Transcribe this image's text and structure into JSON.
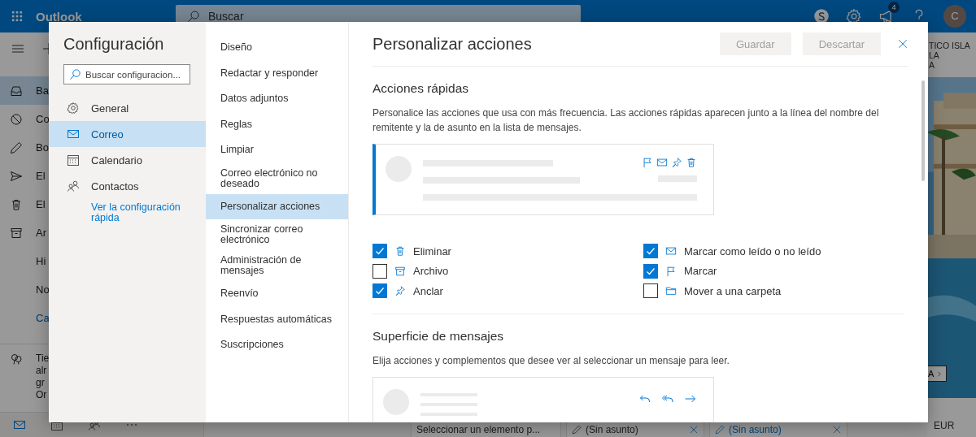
{
  "app": {
    "name": "Outlook",
    "search_placeholder": "Buscar",
    "notification_count": "4",
    "avatar_initial": "C"
  },
  "rail": {
    "items": [
      {
        "label": "Ba",
        "kind": "folder",
        "selected": true
      },
      {
        "label": "Co",
        "kind": "folder",
        "selected": false
      },
      {
        "label": "Bo",
        "kind": "folder",
        "selected": false
      },
      {
        "label": "El",
        "kind": "folder",
        "selected": false
      },
      {
        "label": "El",
        "kind": "folder",
        "selected": false
      },
      {
        "label": "Ar",
        "kind": "folder",
        "selected": false
      },
      {
        "label": "Hi",
        "kind": "folder",
        "selected": false
      },
      {
        "label": "No",
        "kind": "folder",
        "selected": false
      },
      {
        "label": "Ca",
        "kind": "link",
        "selected": false
      }
    ],
    "promo_lines": [
      "Tie",
      "alr",
      "gr",
      "Or"
    ]
  },
  "ad": {
    "lines": [
      "TICO ISLA",
      "LA",
      "A"
    ],
    "button": "A",
    "price": "EUR"
  },
  "bottom_tabs": [
    {
      "label": "Seleccionar un elemento p...",
      "kind": "plain"
    },
    {
      "label": "(Sin asunto)",
      "kind": "draft"
    },
    {
      "label": "(Sin asunto)",
      "kind": "draft-active"
    }
  ],
  "settings": {
    "title": "Configuración",
    "search_placeholder": "Buscar configuracion...",
    "categories": [
      {
        "label": "General",
        "selected": false
      },
      {
        "label": "Correo",
        "selected": true
      },
      {
        "label": "Calendario",
        "selected": false
      },
      {
        "label": "Contactos",
        "selected": false
      }
    ],
    "quick_link": "Ver la configuración rápida",
    "subsections": [
      {
        "label": "Diseño",
        "selected": false
      },
      {
        "label": "Redactar y responder",
        "selected": false
      },
      {
        "label": "Datos adjuntos",
        "selected": false
      },
      {
        "label": "Reglas",
        "selected": false
      },
      {
        "label": "Limpiar",
        "selected": false
      },
      {
        "label": "Correo electrónico no deseado",
        "selected": false
      },
      {
        "label": "Personalizar acciones",
        "selected": true
      },
      {
        "label": "Sincronizar correo electrónico",
        "selected": false
      },
      {
        "label": "Administración de mensajes",
        "selected": false
      },
      {
        "label": "Reenvío",
        "selected": false
      },
      {
        "label": "Respuestas automáticas",
        "selected": false
      },
      {
        "label": "Suscripciones",
        "selected": false
      }
    ],
    "panel": {
      "title": "Personalizar acciones",
      "buttons": [
        {
          "label": "Guardar",
          "disabled": true
        },
        {
          "label": "Descartar",
          "disabled": true
        }
      ],
      "quick_actions": {
        "heading": "Acciones rápidas",
        "description": "Personalice las acciones que usa con más frecuencia. Las acciones rápidas aparecen junto a la línea del nombre del remitente y la de asunto en la lista de mensajes.",
        "actions": [
          {
            "label": "Eliminar",
            "checked": true
          },
          {
            "label": "Archivo",
            "checked": false
          },
          {
            "label": "Anclar",
            "checked": true
          },
          {
            "label": "Marcar como leído o no leído",
            "checked": true
          },
          {
            "label": "Marcar",
            "checked": true
          },
          {
            "label": "Mover a una carpeta",
            "checked": false
          }
        ]
      },
      "message_surface": {
        "heading": "Superficie de mensajes",
        "description": "Elija acciones y complementos que desee ver al seleccionar un mensaje para leer."
      }
    }
  }
}
